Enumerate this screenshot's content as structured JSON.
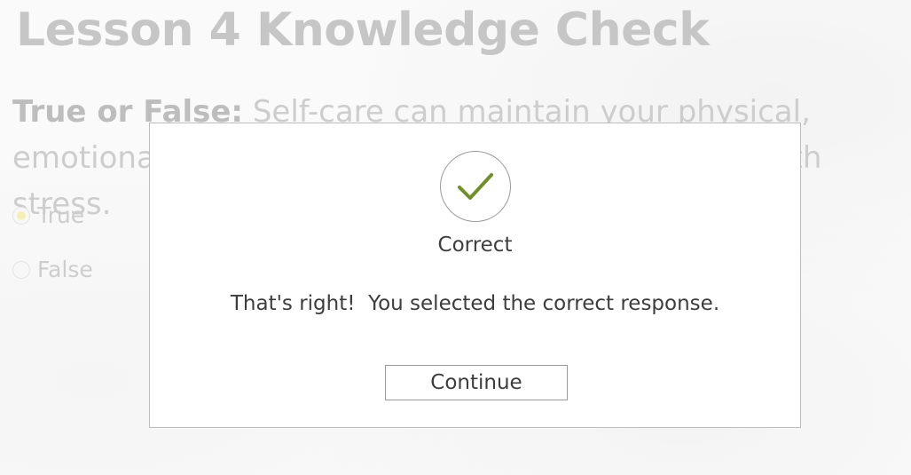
{
  "page": {
    "title": "Lesson 4 Knowledge Check",
    "question_label": "True or False:",
    "question_text": " Self-care can maintain your physical, emotional, and mental health and help you cope with stress.",
    "options": [
      {
        "label": "True",
        "selected": true
      },
      {
        "label": "False",
        "selected": false
      }
    ]
  },
  "modal": {
    "icon": "checkmark-icon",
    "title": "Correct",
    "message": "That's right!  You selected the correct response.",
    "continue_label": "Continue"
  },
  "colors": {
    "check": "#6f8f2a",
    "selected_radio": "#f2e68a"
  }
}
